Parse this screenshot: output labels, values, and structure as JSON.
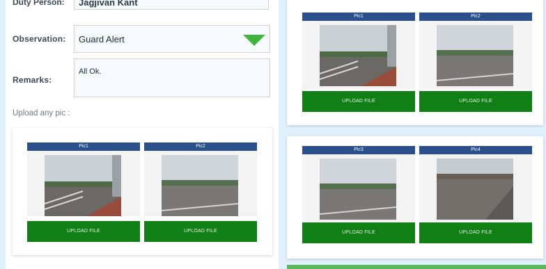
{
  "form": {
    "duty_person_label": "Duty Person:",
    "duty_person_value": "Jagjivan Kant",
    "observation_label": "Observation:",
    "observation_value": "Guard Alert",
    "remarks_label": "Remarks:",
    "remarks_value": "All Ok.",
    "upload_heading": "Upload any pic :"
  },
  "left_card": {
    "pics": [
      {
        "label": "Pic1",
        "button": "UPLOAD FILE",
        "photo": "photo-railing"
      },
      {
        "label": "Pic2",
        "button": "UPLOAD FILE",
        "photo": "photo-lot"
      }
    ]
  },
  "right_top_card": {
    "pics": [
      {
        "label": "Pic1",
        "button": "UPLOAD FILE",
        "photo": "photo-railing"
      },
      {
        "label": "Pic2",
        "button": "UPLOAD FILE",
        "photo": "photo-lot"
      }
    ]
  },
  "right_bottom_card": {
    "pics": [
      {
        "label": "Pic3",
        "button": "UPLOAD FILE",
        "photo": "photo-lot"
      },
      {
        "label": "Pic4",
        "button": "UPLOAD FILE",
        "photo": "photo-rubble"
      }
    ]
  },
  "colors": {
    "pic_header": "#2a4f8a",
    "upload_button": "#107f15",
    "dropdown_arrow": "#3fb43f",
    "background": "#dff1fd"
  }
}
